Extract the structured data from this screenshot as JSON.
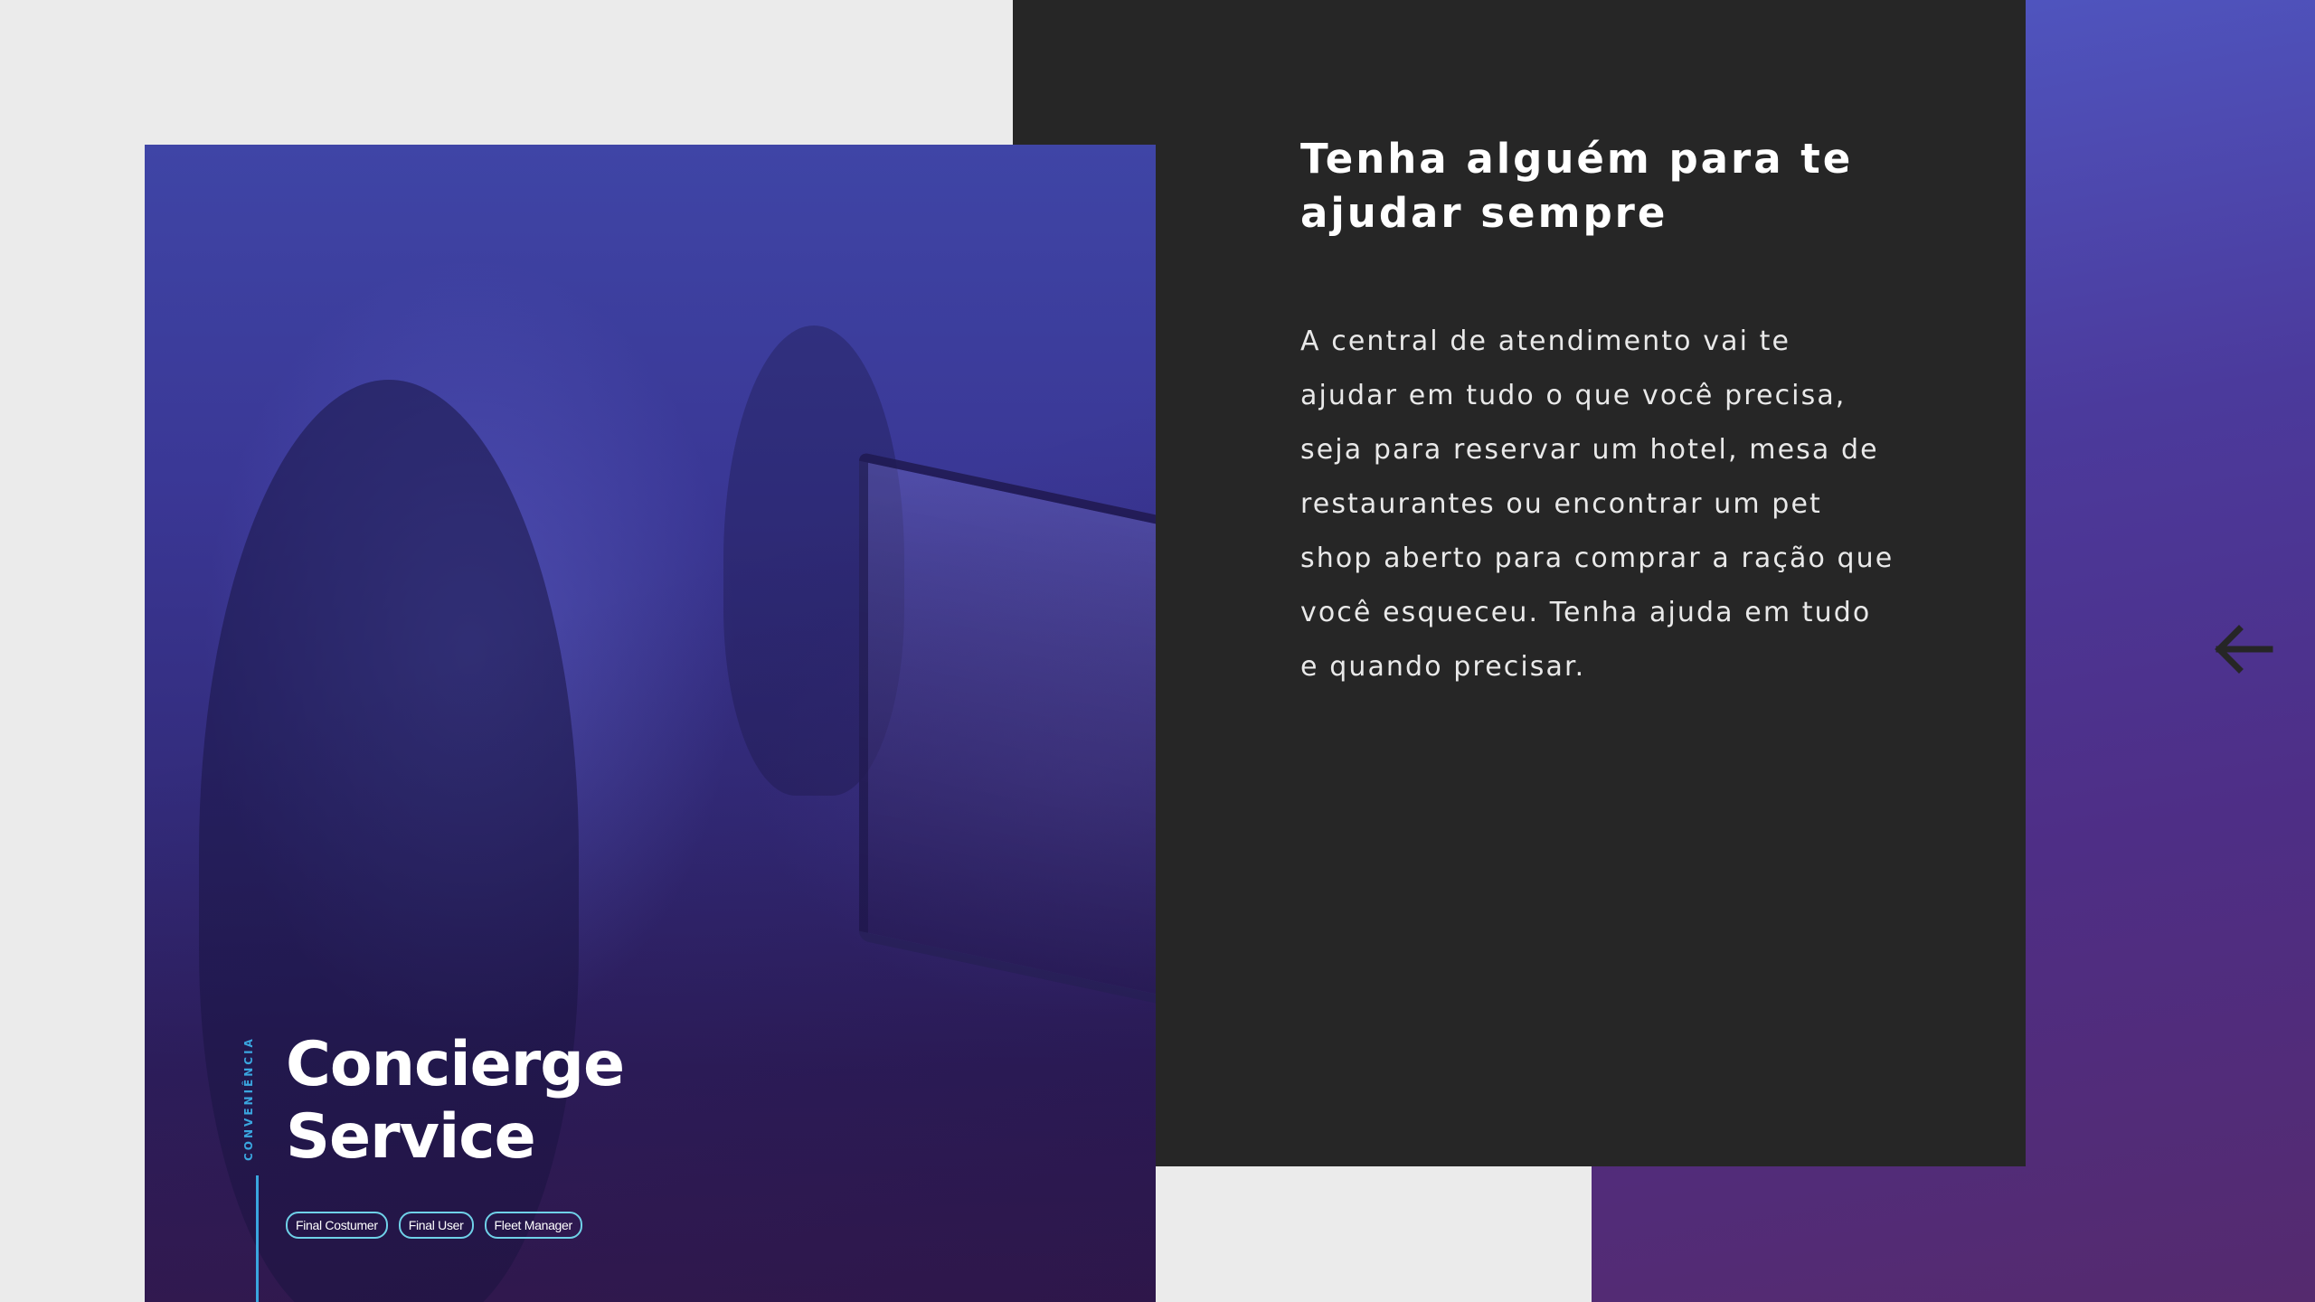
{
  "hero": {
    "category": "CONVENIÊNCIA",
    "title_line1": "Concierge",
    "title_line2": "Service",
    "tags": [
      "Final Costumer",
      "Final User",
      "Fleet Manager"
    ]
  },
  "panel": {
    "heading": "Tenha alguém para te ajudar sempre",
    "body": "A central de atendimento vai te ajudar em tudo o que você precisa, seja para reservar um hotel, mesa de restaurantes ou encontrar um pet shop aberto para comprar a ração que você esqueceu. Tenha ajuda em tudo e quando precisar."
  },
  "navigation": {
    "back_icon": "arrow-left-icon"
  },
  "colors": {
    "accent": "#3aa6df",
    "tag_border": "#6fd1e8",
    "panel_bg": "#262626",
    "page_bg": "#ebebeb"
  }
}
